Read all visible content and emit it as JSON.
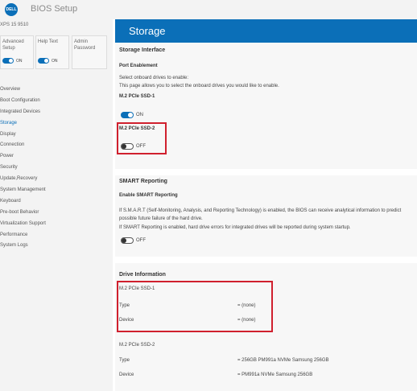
{
  "app": {
    "logo_text": "DELL",
    "title": "BIOS Setup"
  },
  "sidebar": {
    "model": "XPS 15 9510",
    "options": [
      {
        "label": "Advanced Setup",
        "state": "ON"
      },
      {
        "label": "Help Text",
        "state": "ON"
      },
      {
        "label": "Admin Password",
        "state": ""
      }
    ],
    "nav": [
      {
        "label": "Overview"
      },
      {
        "label": "Boot Configuration"
      },
      {
        "label": "Integrated Devices"
      },
      {
        "label": "Storage",
        "active": true
      },
      {
        "label": "Display"
      },
      {
        "label": "Connection"
      },
      {
        "label": "Power"
      },
      {
        "label": "Security"
      },
      {
        "label": "Update,Recovery"
      },
      {
        "label": "System Management"
      },
      {
        "label": "Keyboard"
      },
      {
        "label": "Pre-boot Behavior"
      },
      {
        "label": "Virtualization Support"
      },
      {
        "label": "Performance"
      },
      {
        "label": "System Logs"
      }
    ]
  },
  "main": {
    "title": "Storage",
    "storage_interface": {
      "heading": "Storage Interface",
      "port_enablement": "Port Enablement",
      "desc1": "Select onboard drives to enable:",
      "desc2": "This page allows you to select the onboard drives you would like to enable.",
      "ssd1": {
        "label": "M.2 PCIe SSD-1",
        "state": "ON"
      },
      "ssd2": {
        "label": "M.2 PCIe SSD-2",
        "state": "OFF"
      }
    },
    "smart": {
      "heading": "SMART Reporting",
      "enable_label": "Enable SMART Reporting",
      "desc1": "If S.M.A.R.T (Self-Monitoring, Analysis, and Reporting Technology) is enabled, the BIOS can receive analytical information to predict",
      "desc2": "possible future failure of the hard drive.",
      "desc3": "If SMART Reporting is enabled, hard drive errors for integrated drives will be reported during system startup.",
      "state": "OFF"
    },
    "drive_info": {
      "heading": "Drive Information",
      "drives": [
        {
          "name": "M.2 PCIe SSD-1",
          "type_label": "Type",
          "type_value": "= (none)",
          "device_label": "Device",
          "device_value": "= (none)"
        },
        {
          "name": "M.2 PCIe SSD-2",
          "type_label": "Type",
          "type_value": "= 256GB PM991a NVMe Samsung 256GB",
          "device_label": "Device",
          "device_value": "= PM991a NVMe Samsung 256GB"
        }
      ]
    }
  },
  "colors": {
    "accent": "#0b6fb8",
    "highlight": "#d0202e",
    "panel_bg": "#f7f7f7",
    "sidebar_bg": "#f3f3f3"
  }
}
